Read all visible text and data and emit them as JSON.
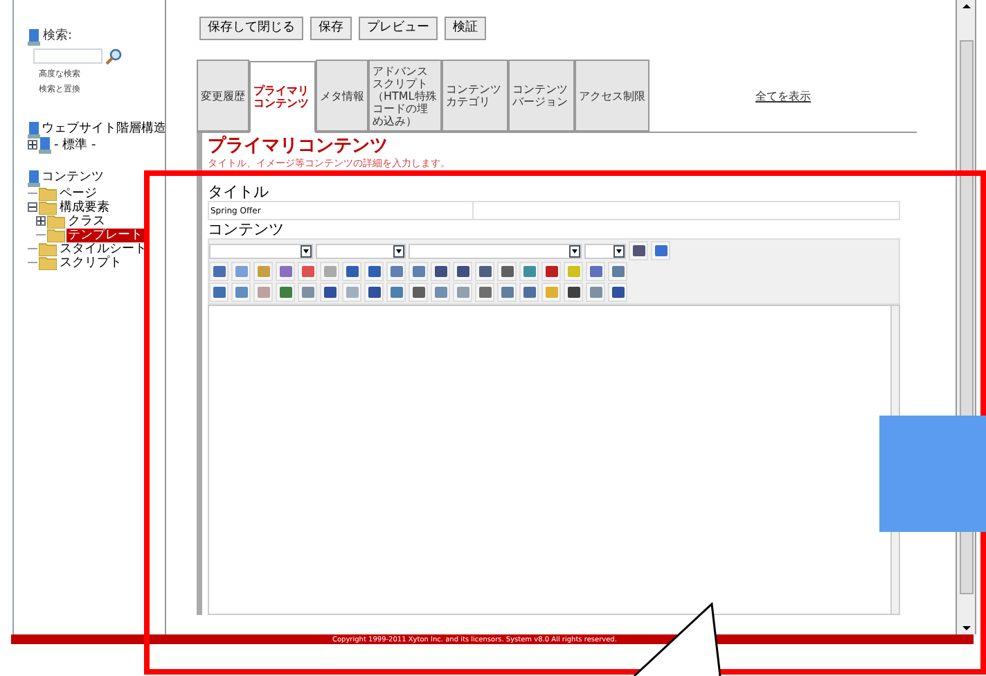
{
  "sidebar": {
    "search": {
      "label": "検索:",
      "links": [
        "高度な検索",
        "検索と置換"
      ]
    },
    "trees": [
      {
        "label": "ウェブサイト階層構造",
        "expanded": true,
        "children": [
          {
            "label": "- 標準 -",
            "kind": "site",
            "expanded": false,
            "selected": false
          }
        ]
      },
      {
        "label": "コンテンツ",
        "expanded": true,
        "children": [
          {
            "label": "ページ",
            "kind": "folder",
            "selected": false
          },
          {
            "label": "構成要素",
            "kind": "folder",
            "expanded": true,
            "selected": false,
            "children": [
              {
                "label": "クラス",
                "kind": "folder",
                "expanded": false,
                "selected": false
              },
              {
                "label": "テンプレート",
                "kind": "folder",
                "selected": true
              }
            ]
          },
          {
            "label": "スタイルシート",
            "kind": "folder",
            "selected": false
          },
          {
            "label": "スクリプト",
            "kind": "folder",
            "selected": false
          }
        ]
      }
    ]
  },
  "buttons": [
    "保存して閉じる",
    "保存",
    "プレビュー",
    "検証"
  ],
  "tabs": [
    {
      "label": "変更履歴",
      "selected": false
    },
    {
      "label": "プライマリコンテンツ",
      "selected": true
    },
    {
      "label": "メタ情報",
      "selected": false
    },
    {
      "label": "アドバンススクリプト（HTML特殊コードの埋め込み）",
      "selected": false
    },
    {
      "label": "コンテンツカテゴリ",
      "selected": false
    },
    {
      "label": "コンテンツバージョン",
      "selected": false
    },
    {
      "label": "アクセス制限",
      "selected": false
    }
  ],
  "show_all_link": "全てを表示",
  "section": {
    "heading": "プライマリコンテンツ",
    "description": "タイトル、イメージ等コンテンツの詳細を入力します。"
  },
  "title_field": {
    "label": "タイトル",
    "value": "Spring Offer"
  },
  "content_label": "コンテンツ",
  "footer": "Copyright 1999-2011 Xyton Inc. and its licensors. System v8.0 All rights reserved."
}
